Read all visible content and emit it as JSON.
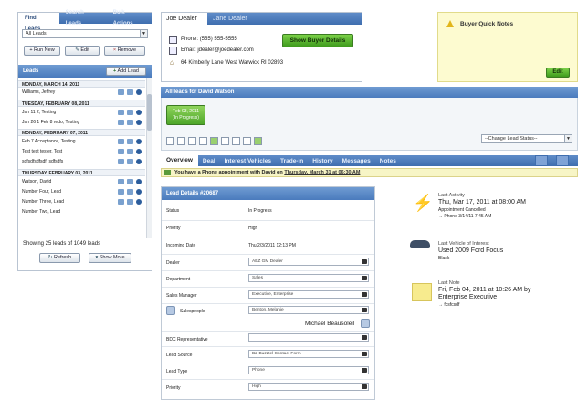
{
  "left_panel": {
    "tabs": [
      "Find Leads",
      "Search Leads",
      "Bulk Actions"
    ],
    "filter_select": "All Leads",
    "buttons": {
      "run_new": "+ Run New",
      "edit": "Edit",
      "remove": "Remove"
    },
    "leads_header": "Leads",
    "add_lead": "Add Lead",
    "groups": [
      {
        "day": "MONDAY, MARCH 14, 2011",
        "leads": [
          "Williams, Jeffrey"
        ]
      },
      {
        "day": "TUESDAY, FEBRUARY 08, 2011",
        "leads": [
          "Jan 11 2, Testing",
          "Jan 26 1 Feb 8 redo, Testing"
        ]
      },
      {
        "day": "MONDAY, FEBRUARY 07, 2011",
        "leads": [
          "Feb 7 Acceptance, Testing",
          "Test test tester, Test",
          "sdfsdfsdfsdf, sdfsdfs"
        ]
      },
      {
        "day": "THURSDAY, FEBRUARY 03, 2011",
        "leads": [
          "Watson, David",
          "Number Four, Lead",
          "Number Three, Lead",
          "Number Two, Lead"
        ]
      }
    ],
    "showing": "Showing 25 leads of 1049 leads",
    "refresh": "Refresh",
    "show_more": "Show More"
  },
  "contact": {
    "tabs": [
      "Joe Dealer",
      "Jane Dealer"
    ],
    "phone": "Phone: (555) 555-5555",
    "email": "Email: jdealer@joedealer.com",
    "address": "64 Kimberly Lane West Warwick RI 02893",
    "show_details": "Show Buyer Details"
  },
  "quick_notes": {
    "title": "Buyer Quick Notes",
    "edit": "Edit"
  },
  "all_leads_header": "All leads for David Watson",
  "lead_chip": {
    "date": "Feb 03, 2011",
    "status": "(In Progress)"
  },
  "change_status": "--Change Lead Status--",
  "main_tabs": [
    "Overview",
    "Deal",
    "Interest Vehicles",
    "Trade-In",
    "History",
    "Messages",
    "Notes"
  ],
  "appointment": {
    "text": "You have a Phone appointment with David on",
    "date": "Thursday, March 31 at 06:30 AM"
  },
  "lead_details": {
    "title": "Lead Details #20687",
    "status_label": "Status",
    "status": "In Progress",
    "priority_label": "Priority",
    "priority": "High",
    "incoming_label": "Incoming Date",
    "incoming": "Thu 2/3/2011 12:13 PM",
    "dealer_label": "Dealer",
    "dealer": "ABZ GM Dealer",
    "department_label": "Department",
    "department": "Sales",
    "sales_manager_label": "Sales Manager",
    "sales_manager": "Executive, Enterprise",
    "salespeople_label": "Salespeople",
    "salespeople": "Benton, Melanie",
    "salesperson_2": "Michael Beausoleil",
    "bdc_label": "BDC Representative",
    "bdc": "",
    "source_label": "Lead Source",
    "source": "BZ Buzztel Contact Form",
    "type_label": "Lead Type",
    "type": "Phone",
    "priority2_label": "Priority",
    "priority2": "High"
  },
  "activity": {
    "last_activity_label": "Last Activity",
    "last_activity_date": "Thu, Mar 17, 2011 at 08:00 AM",
    "last_activity_sub": "Appointment Cancelled",
    "last_activity_link": "→ Phone 3/14/11 7:45 AM",
    "vehicle_label": "Last Vehicle of Interest",
    "vehicle": "Used 2009 Ford Focus",
    "vehicle_color": "Black",
    "note_label": "Last Note",
    "note_date": "Fri, Feb 04, 2011 at 10:26 AM by",
    "note_by": "Enterprise Executive",
    "note_text": "→ fcsfcsdf"
  }
}
